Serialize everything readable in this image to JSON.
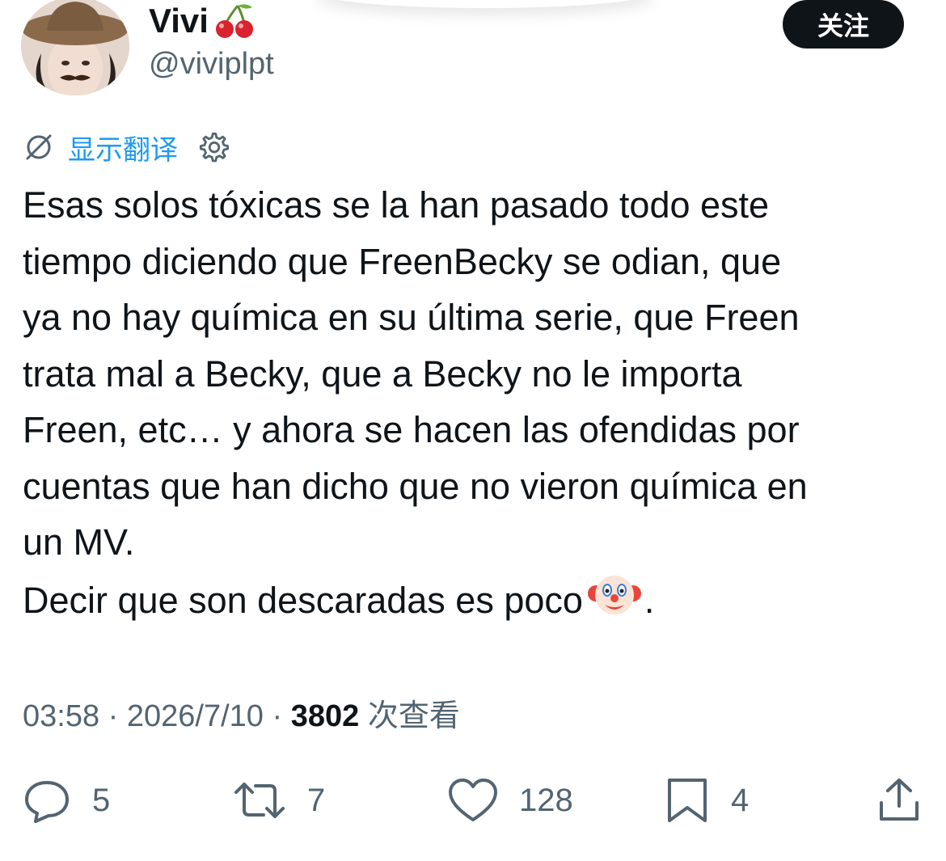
{
  "header": {
    "display_name": "Vivi",
    "handle": "@viviplpt",
    "follow_label": "关注"
  },
  "translation": {
    "show_translation_label": "显示翻译",
    "icons": [
      "translate-off-icon",
      "gear-icon"
    ]
  },
  "tweet": {
    "text": "Esas solos tóxicas se la han pasado todo este\ntiempo diciendo que FreenBecky se odian, que\nya no hay química en su última serie, que Freen\ntrata mal a Becky, que a Becky no le importa\nFreen, etc… y ahora se hacen las ofendidas por\ncuentas que han dicho que no vieron química en\nun MV.\nDecir que son descaradas es poco",
    "text_end": "."
  },
  "meta": {
    "time": "03:58",
    "separator": " · ",
    "date": "2026/7/10",
    "views_count": "3802",
    "views_label": "次查看"
  },
  "actions": {
    "replies": "5",
    "retweets": "7",
    "likes": "128",
    "bookmarks": "4"
  },
  "colors": {
    "accent": "#1d9bf0",
    "text": "#0f1419",
    "secondary": "#536471",
    "follow_button_bg": "#0f1419"
  }
}
